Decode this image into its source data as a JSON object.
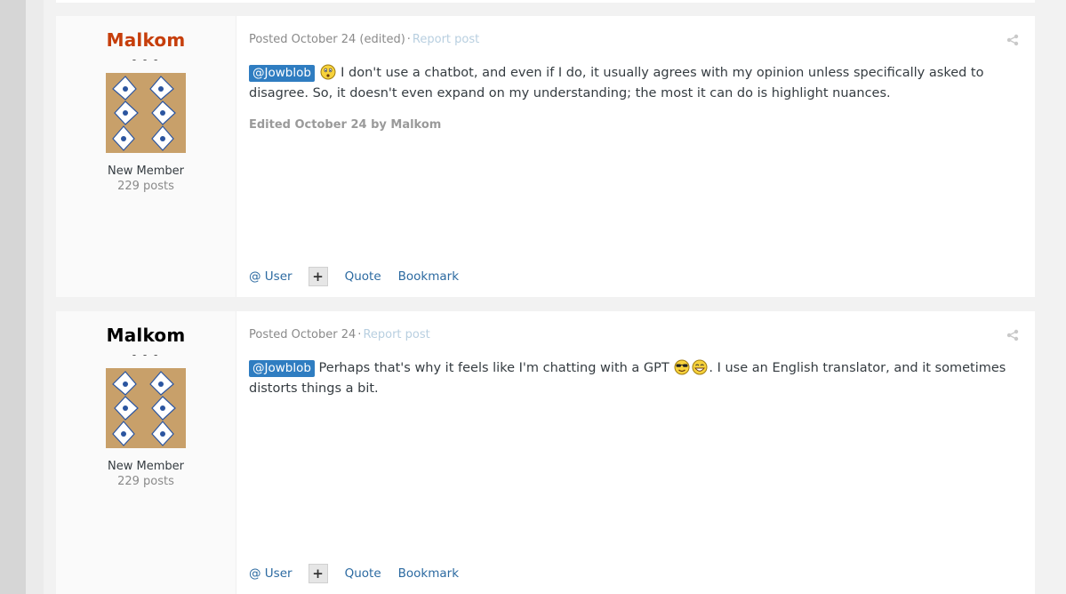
{
  "colors": {
    "author_highlight": "#c63e0b",
    "author_default": "#000000",
    "mention_bg": "#2f7dc1",
    "link": "#2c6aa1",
    "muted": "#8a8a8a"
  },
  "controls": {
    "user_label": "User",
    "plus_label": "+",
    "quote_label": "Quote",
    "bookmark_label": "Bookmark"
  },
  "posts": [
    {
      "author": "Malkom",
      "author_color": "#c63e0b",
      "dashes": "- - -",
      "rank": "New Member",
      "post_count": "229 posts",
      "meta": "Posted October 24 (edited)",
      "report_label": "Report post",
      "mention": "@Jowblob",
      "emoji": [
        "confused-emoji"
      ],
      "text": "I don't use a chatbot, and even if I do, it usually agrees with my opinion unless specifically asked to disagree. So, it doesn't even expand on my understanding; the most it can do is highlight nuances.",
      "edited": "Edited October 24 by Malkom"
    },
    {
      "author": "Malkom",
      "author_color": "#000000",
      "dashes": "- - -",
      "rank": "New Member",
      "post_count": "229 posts",
      "meta": "Posted October 24",
      "report_label": "Report post",
      "mention": "@Jowblob",
      "text_before": "Perhaps that's why it feels like I'm chatting with a GPT",
      "emoji": [
        "cool-sunglasses-emoji",
        "grin-emoji"
      ],
      "text_after": ". I use an English translator, and it sometimes distorts things a bit."
    }
  ]
}
